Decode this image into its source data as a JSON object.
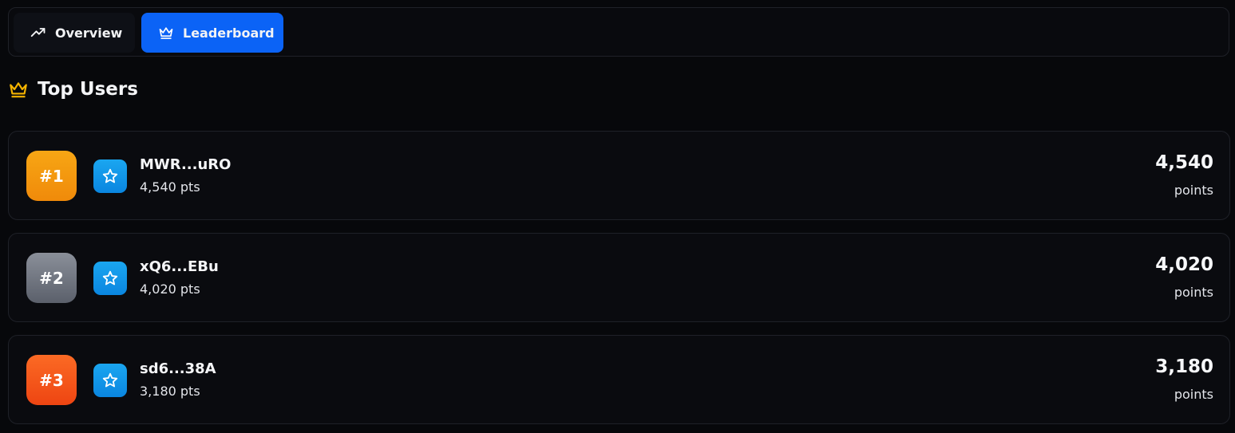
{
  "tabs": [
    {
      "label": "Overview",
      "icon": "trending-up-icon",
      "active": false
    },
    {
      "label": "Leaderboard",
      "icon": "crown-icon",
      "active": true
    }
  ],
  "section": {
    "title": "Top Users",
    "icon": "crown-icon"
  },
  "leaderboard": [
    {
      "rank": "#1",
      "name": "MWR...uRO",
      "pts": "4,540 pts",
      "score": "4,540",
      "score_label": "points",
      "badge_color": "#f59e0b",
      "avatar_icon": "star-icon"
    },
    {
      "rank": "#2",
      "name": "xQ6...EBu",
      "pts": "4,020 pts",
      "score": "4,020",
      "score_label": "points",
      "badge_color": "#6b7280",
      "avatar_icon": "star-icon"
    },
    {
      "rank": "#3",
      "name": "sd6...38A",
      "pts": "3,180 pts",
      "score": "3,180",
      "score_label": "points",
      "badge_color": "#f97316",
      "avatar_icon": "star-icon"
    }
  ],
  "colors": {
    "accent": "#0b63f6",
    "crown": "#f5b400",
    "avatar": "#0ea5e9"
  }
}
